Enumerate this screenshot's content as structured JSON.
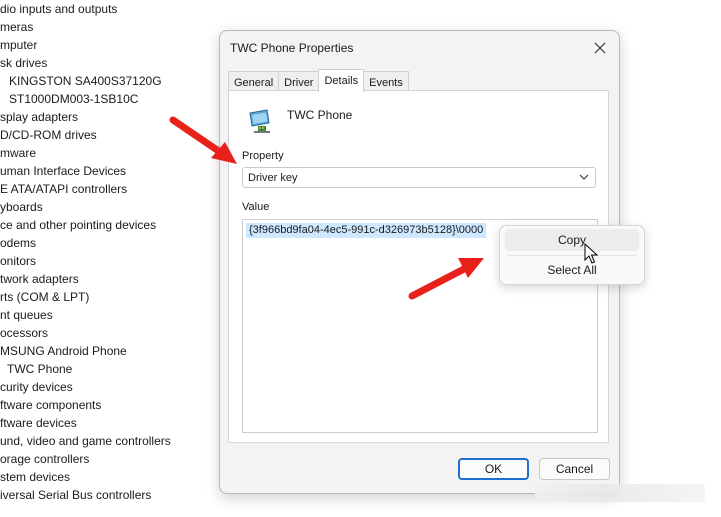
{
  "tree": {
    "items": [
      {
        "label": "dio inputs and outputs",
        "child": false
      },
      {
        "label": "meras",
        "child": false
      },
      {
        "label": "mputer",
        "child": false
      },
      {
        "label": "sk drives",
        "child": false
      },
      {
        "label": "KINGSTON SA400S37120G",
        "child": true
      },
      {
        "label": "ST1000DM003-1SB10C",
        "child": true
      },
      {
        "label": "splay adapters",
        "child": false
      },
      {
        "label": "D/CD-ROM drives",
        "child": false
      },
      {
        "label": "mware",
        "child": false
      },
      {
        "label": "uman Interface Devices",
        "child": false
      },
      {
        "label": "E ATA/ATAPI controllers",
        "child": false
      },
      {
        "label": "yboards",
        "child": false
      },
      {
        "label": "ce and other pointing devices",
        "child": false
      },
      {
        "label": "odems",
        "child": false
      },
      {
        "label": "onitors",
        "child": false
      },
      {
        "label": "twork adapters",
        "child": false
      },
      {
        "label": "rts (COM & LPT)",
        "child": false
      },
      {
        "label": "nt queues",
        "child": false
      },
      {
        "label": "ocessors",
        "child": false
      },
      {
        "label": "MSUNG Android Phone",
        "child": false
      },
      {
        "label": "TWC Phone",
        "child": true
      },
      {
        "label": "curity devices",
        "child": false
      },
      {
        "label": "ftware components",
        "child": false
      },
      {
        "label": "ftware devices",
        "child": false
      },
      {
        "label": "und, video and game controllers",
        "child": false
      },
      {
        "label": "orage controllers",
        "child": false
      },
      {
        "label": "stem devices",
        "child": false
      },
      {
        "label": "iversal Serial Bus controllers",
        "child": false
      }
    ]
  },
  "dialog": {
    "title": "TWC Phone Properties",
    "tabs": [
      "General",
      "Driver",
      "Details",
      "Events"
    ],
    "active_tab": "Details",
    "device_name": "TWC Phone",
    "property_label": "Property",
    "property_value": "Driver key",
    "value_label": "Value",
    "value_text": "{3f966bd9fa04-4ec5-991c-d326973b5128}\\0000",
    "ok_label": "OK",
    "cancel_label": "Cancel"
  },
  "context_menu": {
    "copy_label": "Copy",
    "select_all_label": "Select All"
  },
  "colors": {
    "arrow": "#e8211a",
    "selection": "#cde8ff",
    "ok_border": "#1f6fd0"
  },
  "icons": [
    "close-icon",
    "phone-device-icon",
    "chevron-down-icon",
    "mouse-cursor-icon",
    "red-arrow-icon"
  ]
}
